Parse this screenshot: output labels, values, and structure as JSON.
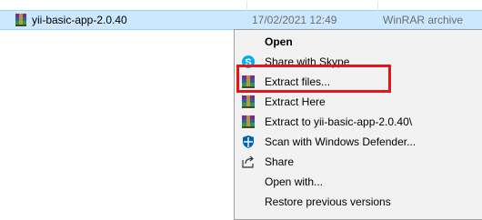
{
  "file": {
    "name": "yii-basic-app-2.0.40",
    "date_modified": "17/02/2021 12:49",
    "type": "WinRAR archive",
    "icon": "winrar-archive-icon"
  },
  "context_menu": {
    "items": [
      {
        "label": "Open",
        "icon": "none",
        "bold": true
      },
      {
        "label": "Share with Skype",
        "icon": "skype-icon"
      },
      {
        "label": "Extract files...",
        "icon": "winrar-icon"
      },
      {
        "label": "Extract Here",
        "icon": "winrar-icon"
      },
      {
        "label": "Extract to yii-basic-app-2.0.40\\",
        "icon": "winrar-icon"
      },
      {
        "label": "Scan with Windows Defender...",
        "icon": "windows-defender-icon"
      },
      {
        "label": "Share",
        "icon": "share-icon"
      },
      {
        "label": "Open with...",
        "icon": "none"
      },
      {
        "label": "Restore previous versions",
        "icon": "none"
      }
    ]
  },
  "colors": {
    "selection_bg": "#cce8ff",
    "menu_bg": "#f2f2f2",
    "highlight_border": "#e8141c",
    "skype_blue": "#00aff0",
    "defender_blue": "#0063b1"
  }
}
